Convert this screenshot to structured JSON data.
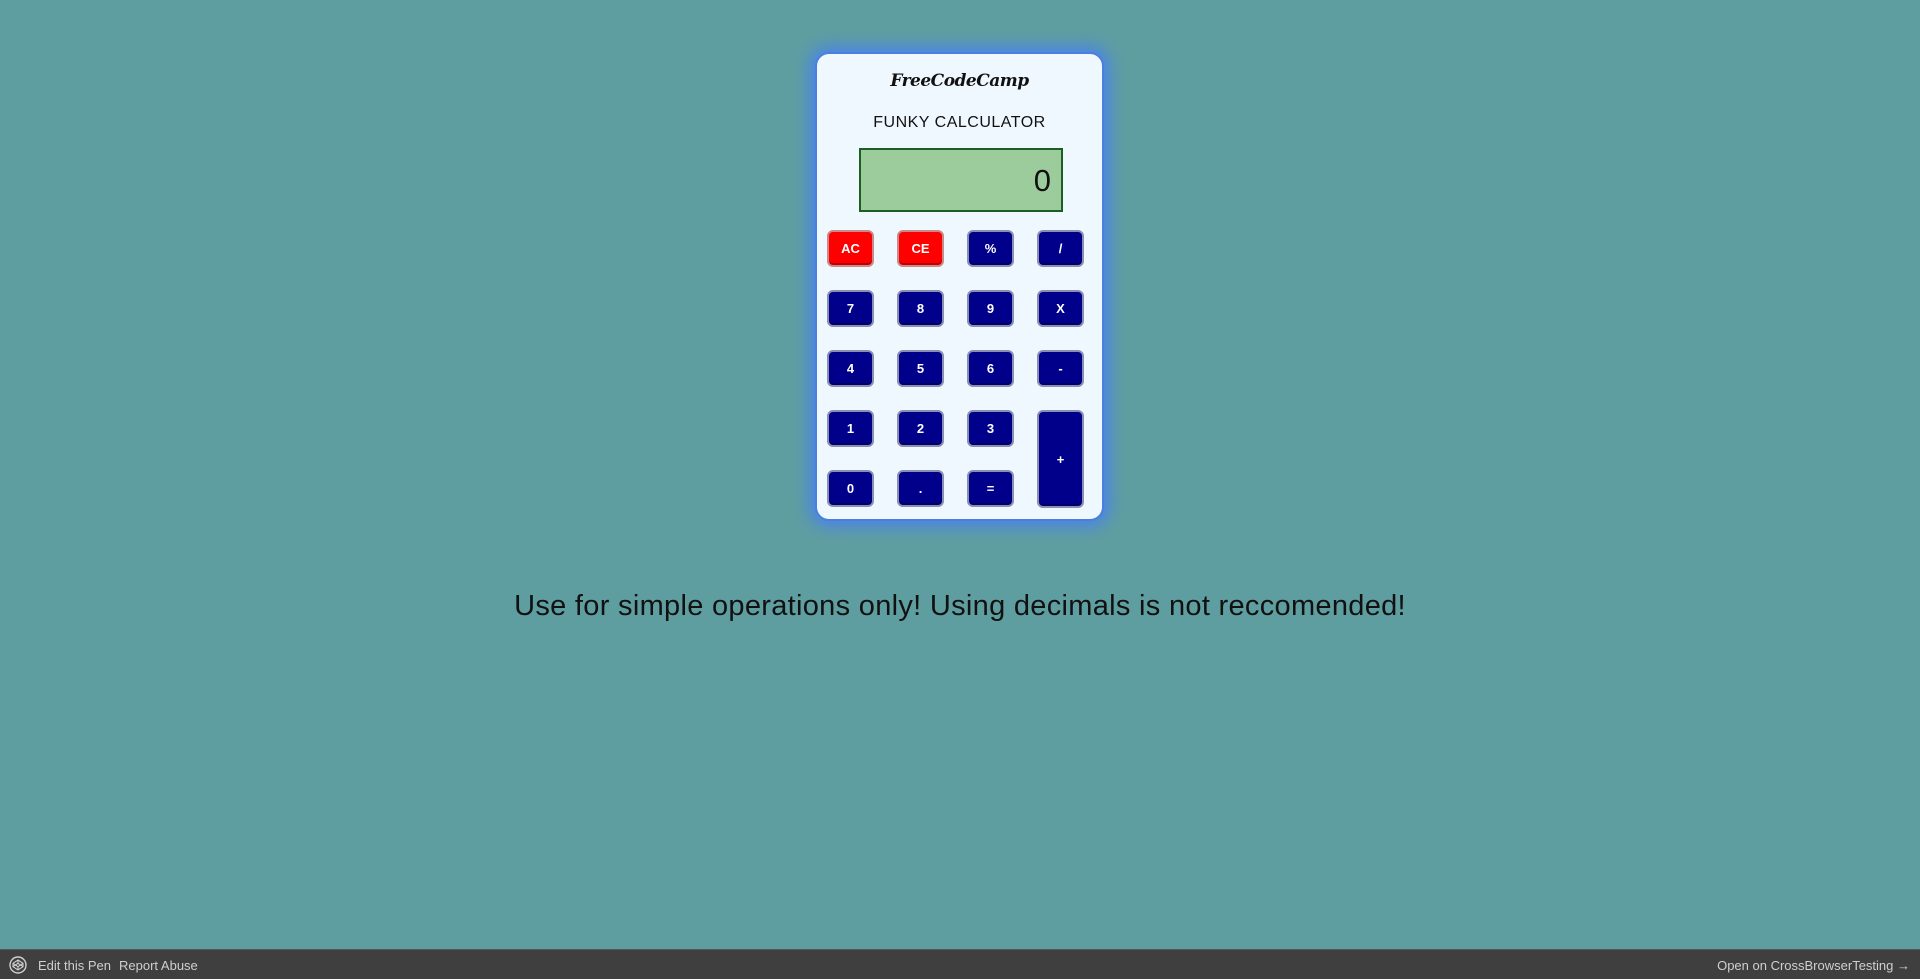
{
  "calculator": {
    "brand": "FreeCodeCamp",
    "title": "FUNKY CALCULATOR",
    "display_value": "0",
    "keys": {
      "ac": "AC",
      "ce": "CE",
      "percent": "%",
      "divide": "/",
      "seven": "7",
      "eight": "8",
      "nine": "9",
      "multiply": "X",
      "four": "4",
      "five": "5",
      "six": "6",
      "minus": "-",
      "one": "1",
      "two": "2",
      "three": "3",
      "plus": "+",
      "zero": "0",
      "decimal": ".",
      "equals": "="
    },
    "colors": {
      "number_key": "#00008b",
      "clear_key": "#ff0000",
      "display_bg": "#9ccc9b",
      "body_bg": "#f0f8ff"
    }
  },
  "notice": "Use for simple operations only! Using decimals is not reccomended!",
  "footer": {
    "logo_icon": "codepen-icon",
    "edit_label": "Edit this Pen",
    "report_label": "Report Abuse",
    "open_label": "Open on CrossBrowserTesting →"
  },
  "page_background": "#5f9ea0"
}
